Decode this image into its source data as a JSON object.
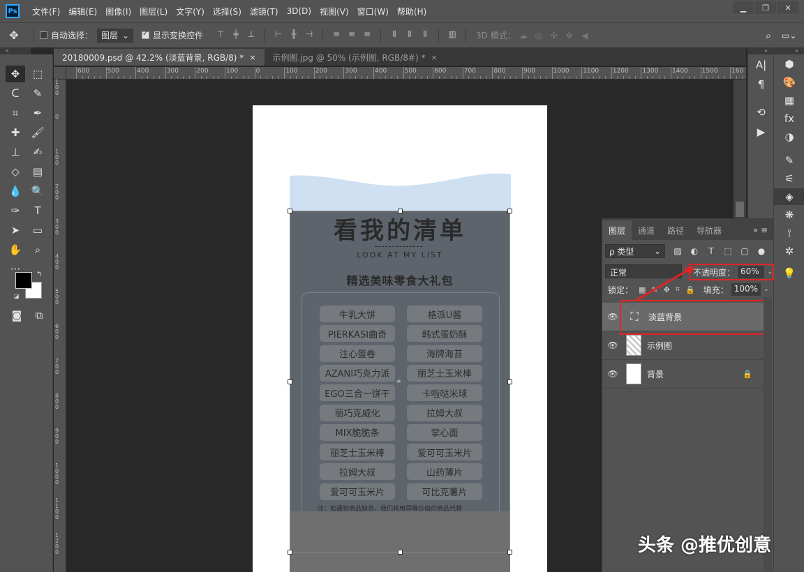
{
  "app": {
    "logo": "Ps",
    "menu": [
      "文件(F)",
      "编辑(E)",
      "图像(I)",
      "图层(L)",
      "文字(Y)",
      "选择(S)",
      "滤镜(T)",
      "3D(D)",
      "视图(V)",
      "窗口(W)",
      "帮助(H)"
    ],
    "window_controls": [
      "minimize-icon",
      "restore-icon",
      "close-icon"
    ]
  },
  "options_bar": {
    "auto_select_label": "自动选择：",
    "auto_select_value": "图层",
    "show_transform_label": "显示变换控件",
    "mode_3d_label": "3D 模式："
  },
  "tabs": [
    {
      "label": "20180009.psd @ 42.2% (淡蓝背景, RGB/8) *",
      "close": "×",
      "active": true
    },
    {
      "label": "示例图.jpg @ 50% (示例图, RGB/8#) *",
      "close": "×",
      "active": false
    }
  ],
  "ruler": {
    "top_labels": [
      "600",
      "500",
      "400",
      "300",
      "200",
      "100",
      "0",
      "100",
      "200",
      "300",
      "400",
      "500",
      "600",
      "700",
      "800",
      "900",
      "1000",
      "1100",
      "1200",
      "1300",
      "1400",
      "1500",
      "160"
    ],
    "left_labels": [
      "1\n0\n0",
      "0",
      "1\n0\n0",
      "2\n0\n0",
      "3\n0\n0",
      "4\n0\n0",
      "5\n0\n0",
      "6\n0\n0",
      "7\n0\n0",
      "8\n0\n0",
      "9\n0\n0",
      "1\n0\n0\n0",
      "1\n1\n0\n0",
      "1\n2\n0\n0"
    ]
  },
  "poster": {
    "title": "看我的清单",
    "subtitle": "LOOK AT MY LIST",
    "heading": "精选美味零食大礼包",
    "items_left": [
      "牛乳大饼",
      "PIERKASI曲奇",
      "注心蛋卷",
      "AZANI巧克力派",
      "EGO三合一饼干",
      "丽巧克威化",
      "MIX脆脆条",
      "丽芝士玉米棒",
      "拉姆大叔",
      "爱可可玉米片"
    ],
    "items_right": [
      "格派U酱",
      "韩式蛋奶酥",
      "海牌海苔",
      "丽芝士玉米棒",
      "卡啦哒米球",
      "拉姆大叔",
      "掌心面",
      "爱可可玉米片",
      "山药薄片",
      "可比克薯片"
    ],
    "note": "注：如遇到商品缺货，我们将用同等价值的商品代替",
    "wave_color": "#cfe0f3",
    "overlay_color": "#5e646c"
  },
  "layers_panel": {
    "tabs": [
      "图层",
      "通道",
      "路径",
      "导航器"
    ],
    "menu_glyph": "»",
    "kind_label": "ρ 类型",
    "blend_mode": "正常",
    "opacity_label": "不透明度：",
    "opacity_value": "60%",
    "lock_label": "锁定：",
    "fill_label": "填充：",
    "fill_value": "100%",
    "layers": [
      {
        "name": "淡蓝背景",
        "selected": true,
        "locked": false
      },
      {
        "name": "示例图",
        "selected": false,
        "locked": false
      },
      {
        "name": "背景",
        "selected": false,
        "locked": true
      }
    ],
    "highlight_color": "#e12525"
  },
  "watermark": "头条 @推优创意"
}
